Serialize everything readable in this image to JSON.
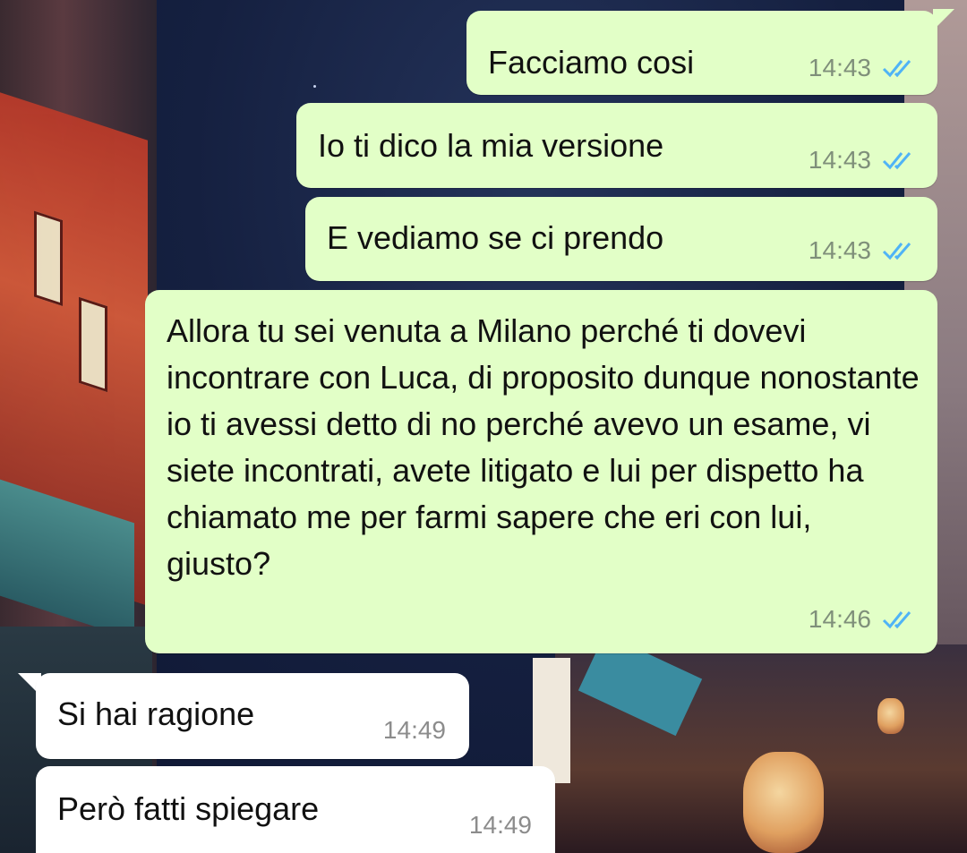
{
  "colors": {
    "outgoing_bubble": "#e2ffc7",
    "incoming_bubble": "#ffffff",
    "read_ticks": "#4fb3f6"
  },
  "icons": {
    "read_receipt": "double-check-icon"
  },
  "messages": [
    {
      "direction": "outgoing",
      "text": "Facciamo cosi",
      "time": "14:43",
      "status": "read"
    },
    {
      "direction": "outgoing",
      "text": "Io ti dico la mia versione",
      "time": "14:43",
      "status": "read"
    },
    {
      "direction": "outgoing",
      "text": "E vediamo se ci prendo",
      "time": "14:43",
      "status": "read"
    },
    {
      "direction": "outgoing",
      "text": "Allora tu sei venuta a Milano perché ti dovevi incontrare con Luca, di proposito dunque nonostante io ti avessi detto di no perché avevo un esame, vi siete incontrati, avete litigato e lui per dispetto ha chiamato me per farmi sapere che eri con lui, giusto?",
      "time": "14:46",
      "status": "read"
    },
    {
      "direction": "incoming",
      "text": "Si hai ragione",
      "time": "14:49"
    },
    {
      "direction": "incoming",
      "text": "Però fatti spiegare",
      "time": "14:49"
    }
  ]
}
